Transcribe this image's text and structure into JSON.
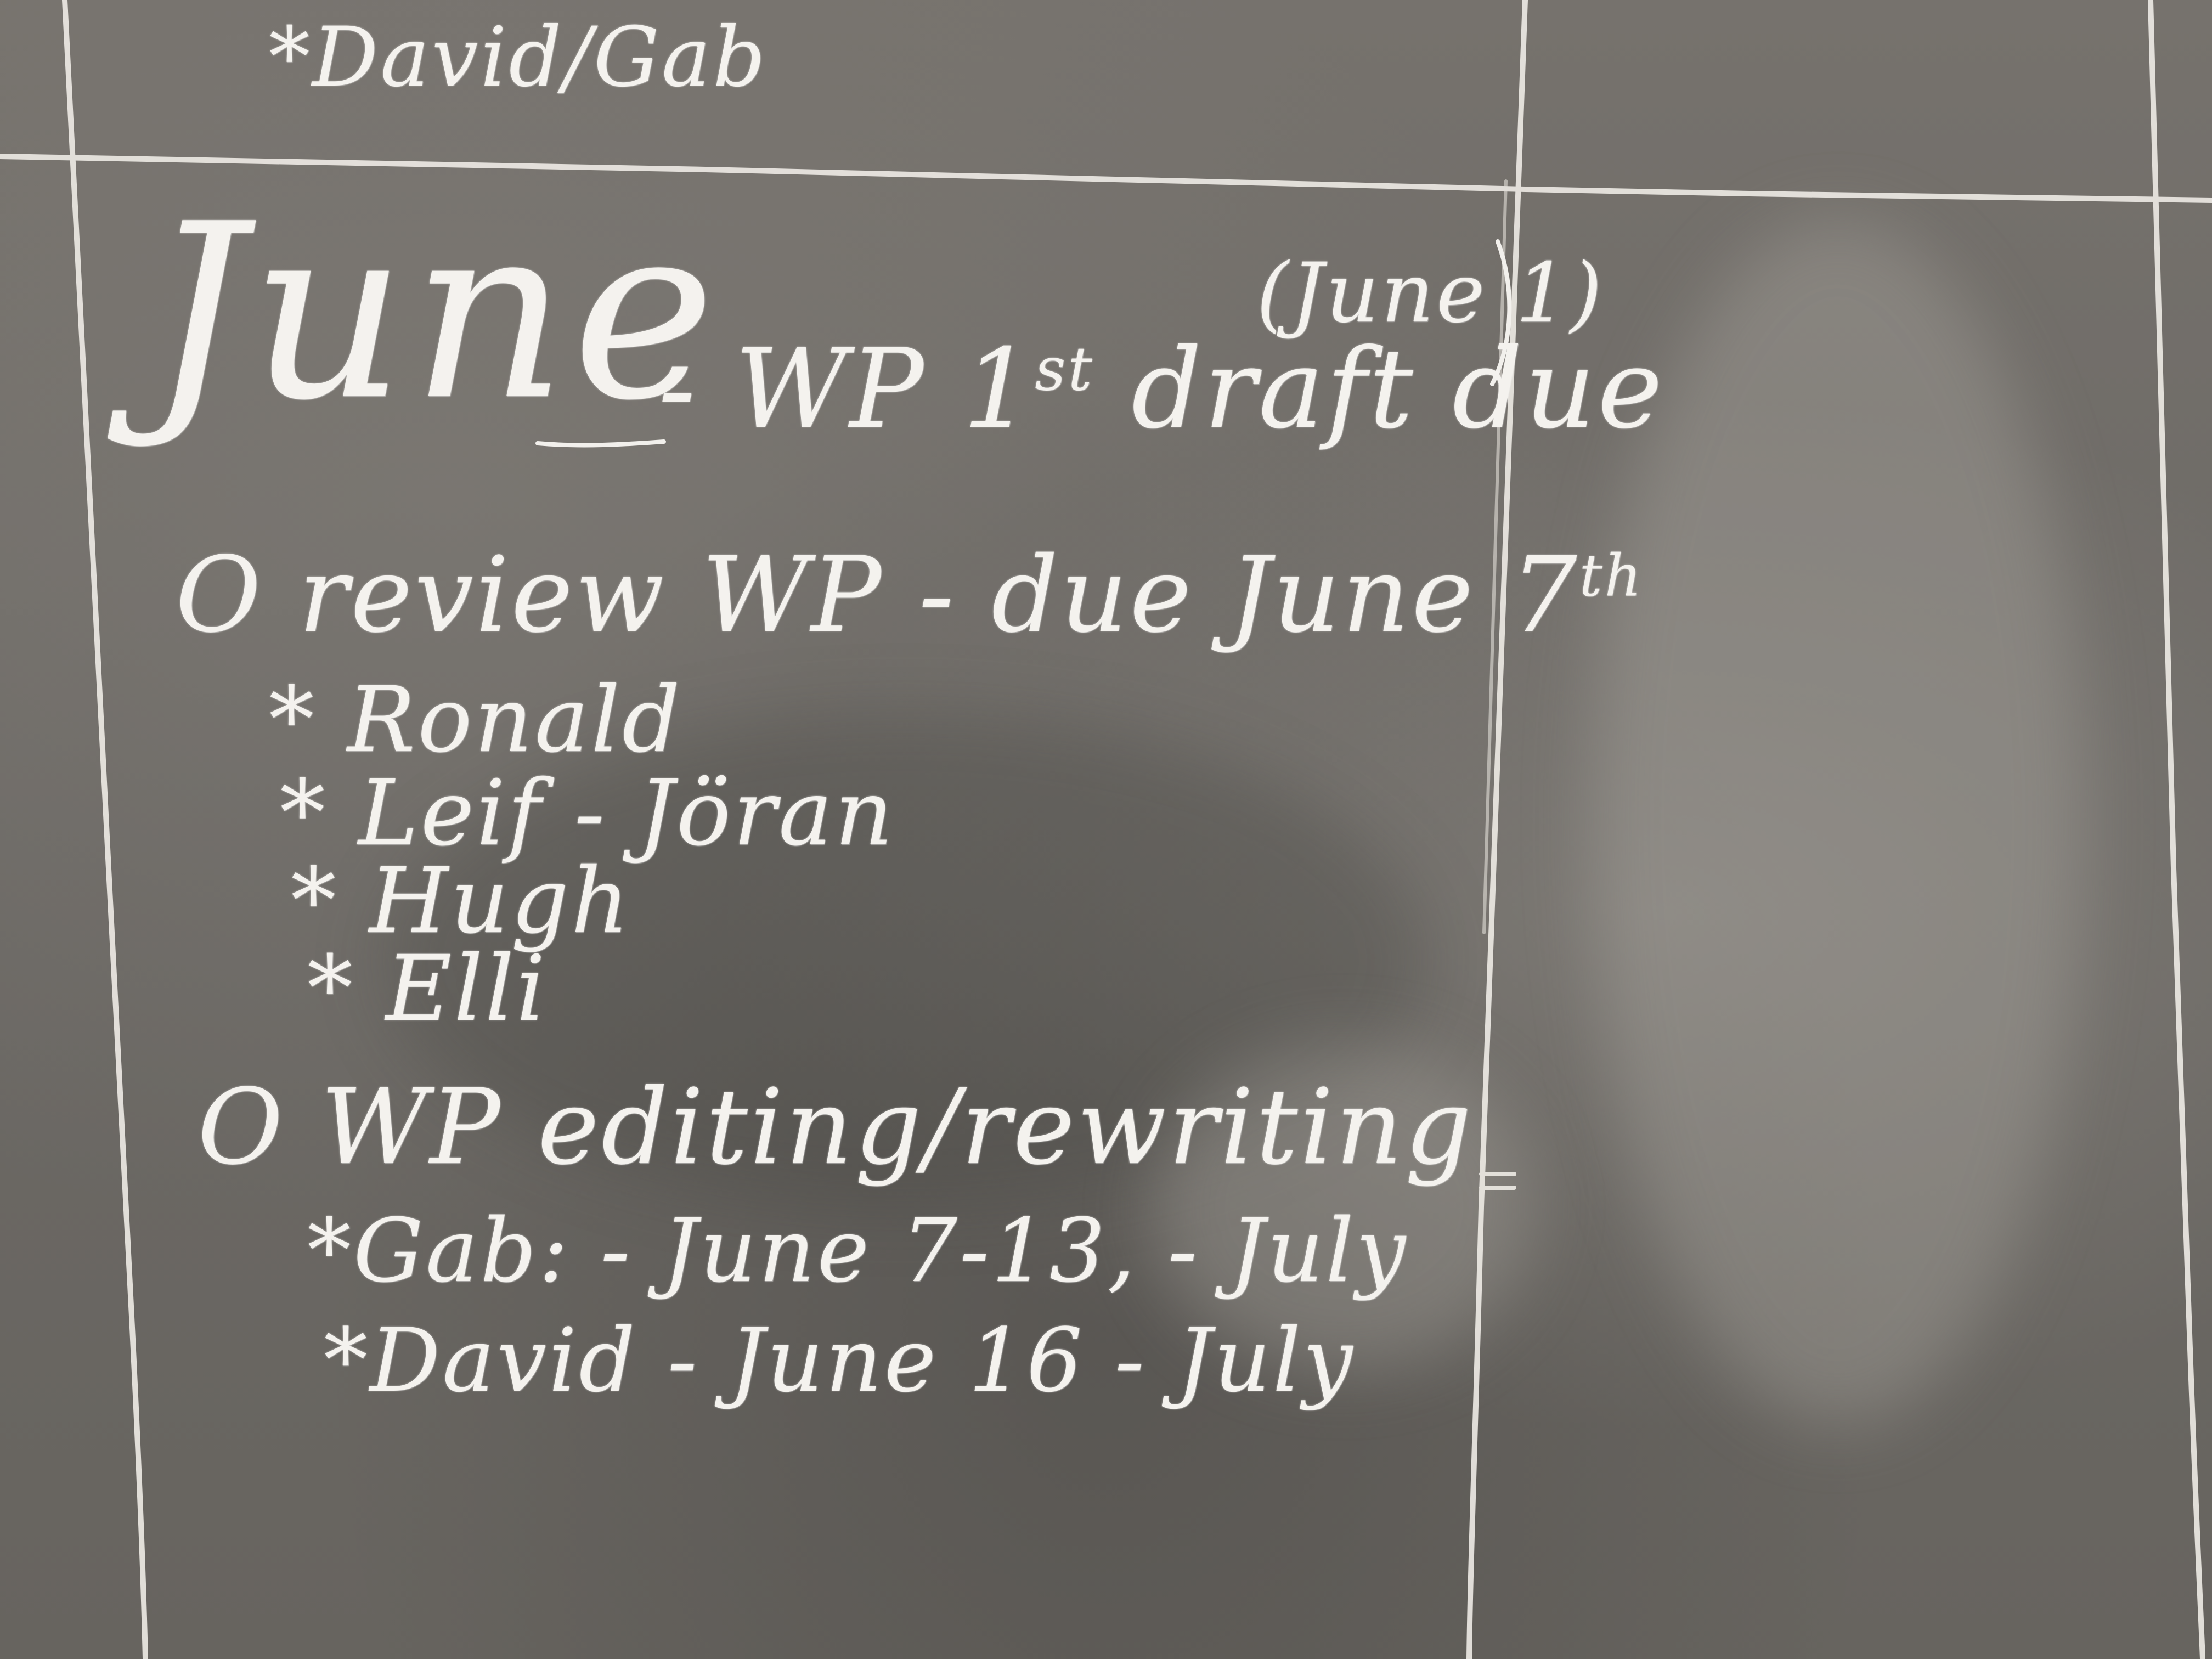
{
  "board": {
    "top_item": "*David/Gab",
    "heading": {
      "month": "June",
      "task": "- WP 1",
      "task_sup": "st",
      "task_rest": "draft due",
      "note": "(June 1)"
    },
    "section1": {
      "title": "O review WP - due June 7",
      "title_sup": "th",
      "reviewers": [
        "* Ronald",
        "* Leif - Jöran",
        "* Hugh",
        "* Elli"
      ]
    },
    "section2": {
      "title_a": "O WP editing/",
      "title_b": "rewriting",
      "rows": [
        "*Gab: - June 7-13, - July",
        "*David - June 16 - July"
      ]
    }
  }
}
